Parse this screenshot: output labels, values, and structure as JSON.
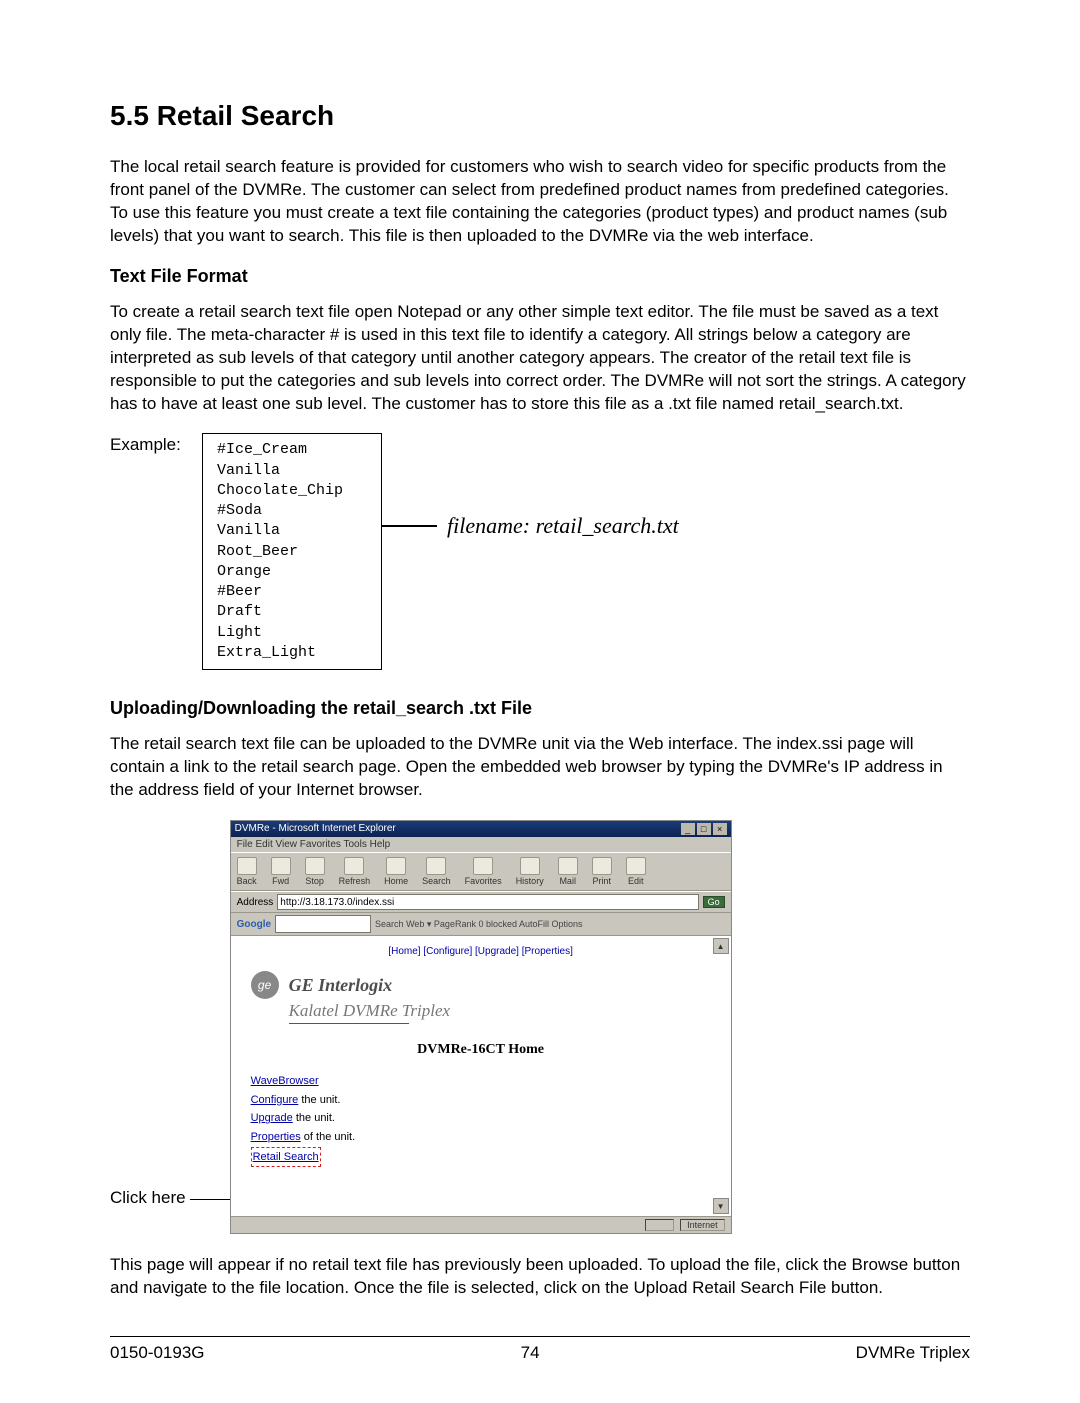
{
  "heading": "5.5  Retail Search",
  "intro": " The local retail search feature is provided for customers who wish to search video for specific products from the front panel of the DVMRe. The customer can select from predefined product names from predefined categories. To use this feature you must create a text file containing the categories (product types) and product names (sub levels) that you want to search. This file is then uploaded to the DVMRe via the web interface.",
  "sub1": "Text File Format",
  "para1": "To create a retail search text file open Notepad or any other simple text editor. The file must be saved as a text only file. The meta-character # is used in this text file to identify a category. All strings below a category are interpreted as sub levels of that category until another category appears. The creator of the retail text file is responsible to put the categories and sub levels into correct order. The DVMRe will not sort the strings. A category has to have at least one sub level. The customer has to store this file as a .txt file named retail_search.txt.",
  "example_label": "Example:",
  "code": "#Ice_Cream\nVanilla\nChocolate_Chip\n#Soda\nVanilla\nRoot_Beer\nOrange\n#Beer\nDraft\nLight\nExtra_Light",
  "filename_caption": "filename: retail_search.txt",
  "sub2": "Uploading/Downloading the retail_search .txt File",
  "para2": "The retail search text file can be uploaded to the DVMRe unit via the Web interface. The index.ssi page will contain a link to the retail search page. Open the embedded web browser by typing the DVMRe's IP address in the address field of your Internet browser.",
  "click_here": "Click here",
  "browser": {
    "title": "DVMRe - Microsoft Internet Explorer",
    "menu": "File   Edit   View   Favorites   Tools   Help",
    "tb": [
      "Back",
      "Fwd",
      "Stop",
      "Refresh",
      "Home",
      "Search",
      "Favorites",
      "History",
      "Mail",
      "Print",
      "Edit"
    ],
    "addr_label": "Address",
    "addr_value": "http://3.18.173.0/index.ssi",
    "go": "Go",
    "google": "Google",
    "gbtns": "Search Web  ▾   PageRank   0 blocked   AutoFill   Options",
    "toplinks": "[Home] [Configure] [Upgrade] [Properties]",
    "ge": "GE Interlogix",
    "kal": "Kalatel DVMRe Triplex",
    "home": "DVMRe-16CT Home",
    "l1a": "WaveBrowser",
    "l2a": "Configure",
    "l2b": " the unit.",
    "l3a": "Upgrade",
    "l3b": " the unit.",
    "l4a": "Properties",
    "l4b": " of the unit.",
    "l5a": "Retail Search",
    "status": "Internet"
  },
  "para3": "This page will appear if no retail text file has previously been uploaded. To upload the file, click the Browse button and navigate to the file location. Once the file is selected, click on the Upload Retail Search File button.",
  "footer_left": "0150-0193G",
  "footer_mid": "74",
  "footer_right": "DVMRe Triplex"
}
